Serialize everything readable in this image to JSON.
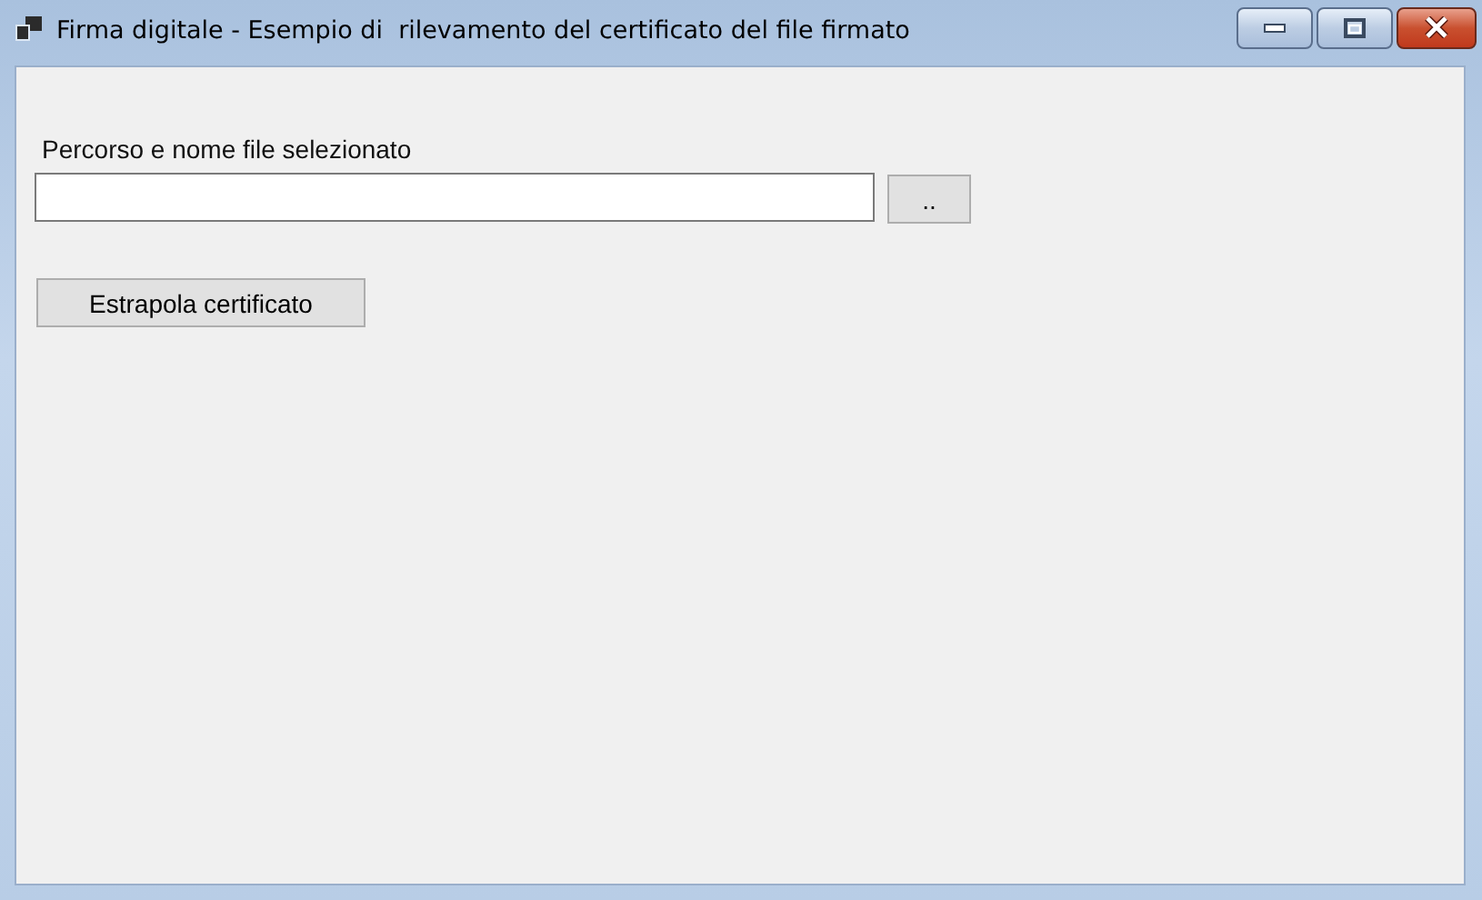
{
  "window": {
    "title": "Firma digitale - Esempio di  rilevamento del certificato del file firmato"
  },
  "file_field": {
    "label": "Percorso e nome file selezionato"
  },
  "browse_button": {
    "label": ".."
  },
  "extract_button": {
    "label": "Estrapola certificato"
  }
}
